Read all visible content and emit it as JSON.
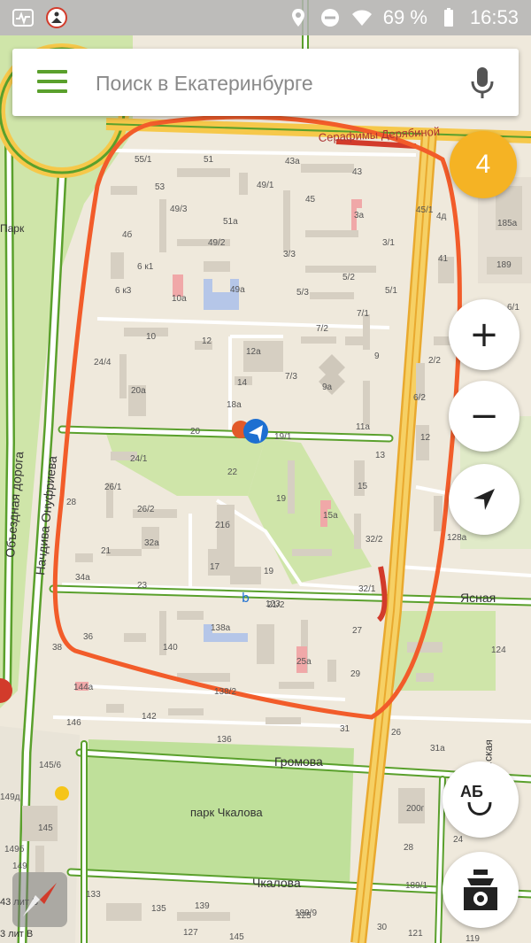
{
  "status_bar": {
    "battery": "69 %",
    "time": "16:53"
  },
  "search": {
    "placeholder": "Поиск в Екатеринбурге"
  },
  "traffic_score": "4",
  "zoom": {
    "plus": "+",
    "minus": "−"
  },
  "route_button_label": "АБ",
  "colors": {
    "accent": "#5aa02c",
    "traffic_badge": "#f5b324",
    "highlight": "#f25c2a",
    "main_road": "#f6c84a"
  },
  "streets": {
    "yasnaya": "Ясная",
    "gromova": "Громова",
    "chkalova": "Чкалова",
    "obezdnaya": "Объездная дорога",
    "nachdiva": "Начдива Онуфриева",
    "serafimy": "Серафимы Дерябиной",
    "sportivnaya": "...ская",
    "park_label": "Парк",
    "park_chkalova": "парк Чкалова",
    "lit_v": "3 лит В",
    "lit_b": "43 лит Б"
  },
  "buildings": [
    "55/1",
    "51",
    "43а",
    "43",
    "53",
    "49/1",
    "45",
    "49/3",
    "51а",
    "3а",
    "4б",
    "49/2",
    "3/1",
    "3/3",
    "6 к1",
    "45/1",
    "5/2",
    "6 к3",
    "10а",
    "49а",
    "5/3",
    "5/1",
    "7/1",
    "7/2",
    "10",
    "12",
    "24/4",
    "12а",
    "9",
    "20а",
    "14",
    "7/3",
    "9а",
    "18а",
    "11а",
    "19/1",
    "20",
    "13",
    "24/1",
    "22",
    "12",
    "26/1",
    "19",
    "15",
    "26/2",
    "28",
    "15а",
    "32а",
    "21б",
    "32/2",
    "21",
    "17",
    "32/1",
    "34а",
    "23",
    "21/2",
    "19",
    "36",
    "138а",
    "27",
    "38",
    "140",
    "25а",
    "29",
    "144а",
    "138/2",
    "142",
    "136",
    "146",
    "31",
    "145/6",
    "149д",
    "145",
    "149б",
    "149",
    "133",
    "135",
    "139",
    "127",
    "145",
    "125",
    "121",
    "119",
    "30",
    "26",
    "31а",
    "200г",
    "28",
    "24",
    "124",
    "128а",
    "185а",
    "189",
    "41",
    "4д",
    "2/2",
    "6/2",
    "6/1",
    "189/9",
    "189/1",
    "123",
    "98г",
    "23"
  ]
}
